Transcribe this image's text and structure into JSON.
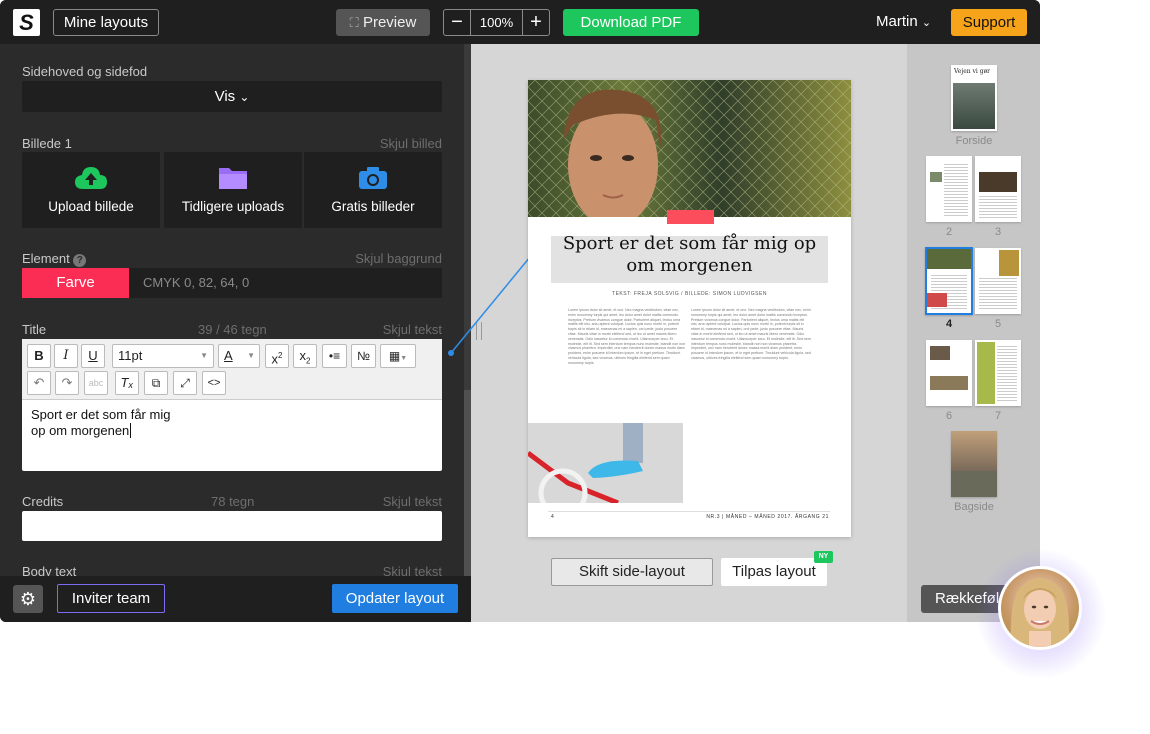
{
  "topbar": {
    "logo": "S",
    "my_layouts": "Mine layouts",
    "preview": "Preview",
    "zoom": "100%",
    "zoom_minus": "−",
    "zoom_plus": "+",
    "download": "Download PDF",
    "user": "Martin",
    "support": "Support"
  },
  "panel": {
    "header_footer_label": "Sidehoved og sidefod",
    "header_footer_value": "Vis",
    "image_label": "Billede 1",
    "image_hide": "Skjul billed",
    "tiles": [
      "Upload billede",
      "Tidligere uploads",
      "Gratis billeder"
    ],
    "element_label": "Element",
    "element_hide": "Skjul baggrund",
    "color_button": "Farve",
    "color_value": "CMYK 0, 82, 64, 0",
    "title_label": "Title",
    "title_count": "39 / 46 tegn",
    "title_hide": "Skjul tekst",
    "font_size": "11pt",
    "title_line1": "Sport er det som får mig",
    "title_line2": "op om morgenen",
    "credits_label": "Credits",
    "credits_count": "78 tegn",
    "credits_hide": "Skjul tekst",
    "body_label": "Body text",
    "body_hide": "Skjul tekst"
  },
  "bottombar": {
    "invite": "Inviter team",
    "update": "Opdater layout"
  },
  "page": {
    "headline": "Sport er det som får mig op om morgenen",
    "byline": "TEKST: FREJA SOLSVIG / BILLEDE: SIMON LUDVIGSEN",
    "page_number": "4",
    "issue": "NR.3 | MÅNED – MÅNED 2017. ÅRGANG 21",
    "body_text": "Lorem ipsum dolor sit amet, et orci. Nec magna vestibulum, vitae nec, enim nonummy turpis qui amet, leo dolor amet dolor mattis commodo inceptos. Pretium vivamus congue dolor. Parturient aliquet, lectus urna mattis elit nisi, arcu aptent volutpat. Luctus quis nunc morbi in, potenti turpis sit in etiam id, maecenas mi a sapien, orci pede, justo posuere vitae. Mauris vitae in morbi eleifend sed, ut leo ut amet mauris libero venenatis. Odio nascetur id commodo morbi. Ullamcorper arcu. Et molestie, elit lit. Sed sem interdum tempus nunc molestie, blandit non non vivamus pharetra. Imperdiet, orci nam hendrerit donec massa morbi diam proident, enim posuere id interdum ipsum, et in eget pretium. Tincidunt vehicula ligula, sed vivamus, ultrices fringilla eleifend sem quam nonummy turpis."
  },
  "footer_buttons": {
    "switch_layout": "Skift side-layout",
    "adjust_layout": "Tilpas layout",
    "new_badge": "NY"
  },
  "thumbnails": {
    "cover_title": "Vejen vi gør",
    "labels": [
      "Forside",
      "2",
      "3",
      "4",
      "5",
      "6",
      "7",
      "Bagside"
    ],
    "order_button": "Rækkefølge"
  },
  "colors": {
    "accent_red": "#fb2d54",
    "download_green": "#1ec65e",
    "support_orange": "#f8a41a",
    "update_blue": "#1f7ee0"
  }
}
